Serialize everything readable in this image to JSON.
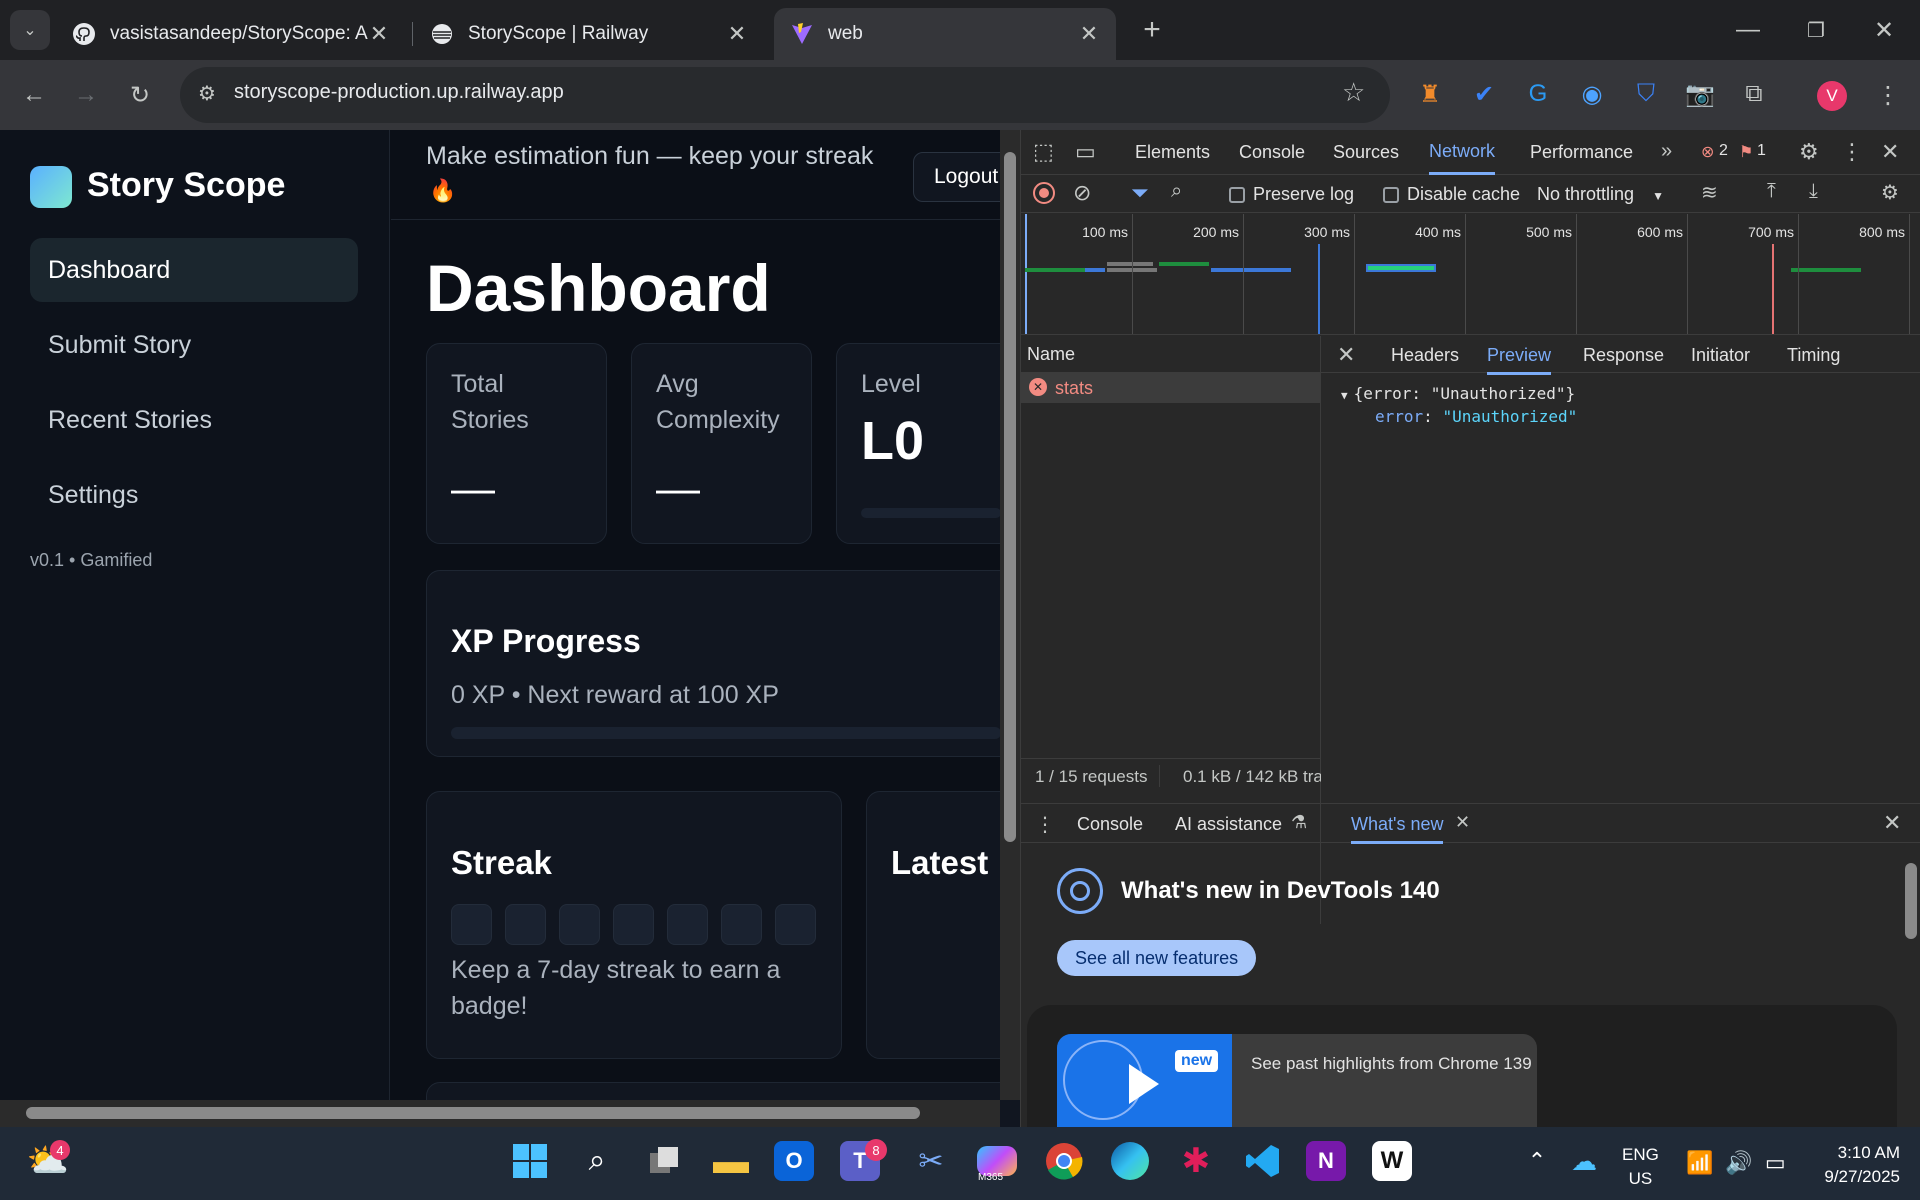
{
  "browser": {
    "tabs": [
      {
        "title": "vasistasandeep/StoryScope: Ap",
        "icon": "github-icon"
      },
      {
        "title": "StoryScope | Railway",
        "icon": "railway-icon"
      },
      {
        "title": "web",
        "icon": "vite-icon"
      }
    ],
    "url": "storyscope-production.up.railway.app",
    "profile_initial": "V"
  },
  "app": {
    "brand": "Story Scope",
    "nav": [
      "Dashboard",
      "Submit Story",
      "Recent Stories",
      "Settings"
    ],
    "version": "v0.1 • Gamified",
    "header_tagline": "Make estimation fun — keep your streak",
    "header_emoji": "🔥",
    "logout": "Logout",
    "page_title": "Dashboard",
    "stats": [
      {
        "label": "Total Stories",
        "value": "—"
      },
      {
        "label": "Avg Complexity",
        "value": "—"
      },
      {
        "label": "Level",
        "value": "L0"
      }
    ],
    "xp": {
      "title": "XP Progress",
      "text": "0 XP • Next reward at 100 XP",
      "progress": 0
    },
    "streak": {
      "title": "Streak",
      "days": 7,
      "text": "Keep a 7-day streak to earn a badge!"
    },
    "latest_title": "Latest"
  },
  "devtools": {
    "tabs": [
      "Elements",
      "Console",
      "Sources",
      "Network",
      "Performance"
    ],
    "active_tab": "Network",
    "error_count": "2",
    "issue_count": "1",
    "preserve_log": "Preserve log",
    "disable_cache": "Disable cache",
    "throttling": "No throttling",
    "timeline_ticks": [
      "100 ms",
      "200 ms",
      "300 ms",
      "400 ms",
      "500 ms",
      "600 ms",
      "700 ms",
      "800 ms"
    ],
    "name_header": "Name",
    "request_name": "stats",
    "detail_tabs": [
      "Headers",
      "Preview",
      "Response",
      "Initiator",
      "Timing"
    ],
    "active_detail": "Preview",
    "preview_summary": "{error: \"Unauthorized\"}",
    "preview_key": "error",
    "preview_value": "\"Unauthorized\"",
    "status_requests": "1 / 15 requests",
    "status_size": "0.1 kB / 142 kB tra",
    "drawer_tabs": [
      "Console",
      "AI assistance",
      "What's new"
    ],
    "whats_new_title": "What's new in DevTools 140",
    "see_all": "See all new features",
    "new_badge": "new",
    "highlight": "See past highlights from Chrome 139"
  },
  "taskbar": {
    "weather_badge": "4",
    "teams_badge": "8",
    "m365_label": "M365",
    "lang": "ENG",
    "region": "US",
    "time": "3:10 AM",
    "date": "9/27/2025"
  },
  "colors": {
    "accent": "#7cacf8",
    "error": "#f28b82",
    "brand_blue": "#4da3ff"
  }
}
